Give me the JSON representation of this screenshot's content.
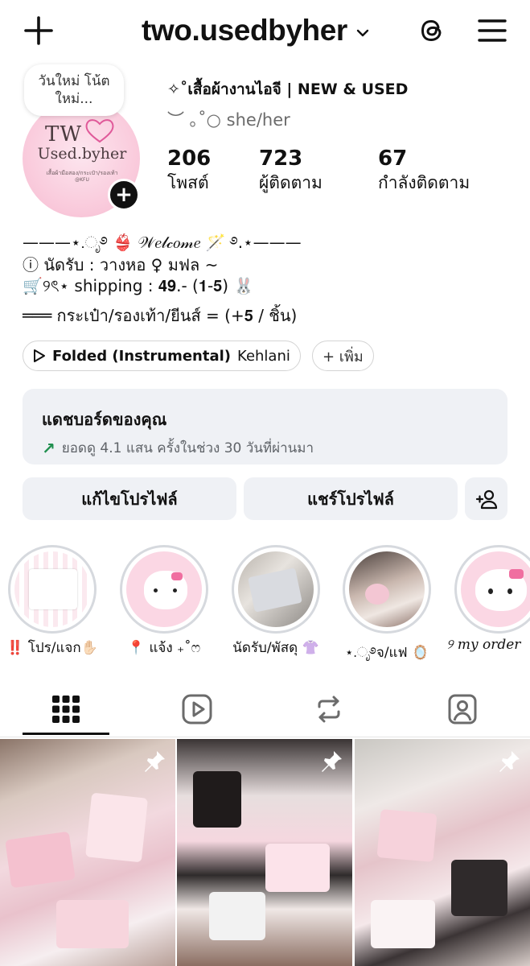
{
  "header": {
    "username": "two.usedbyher",
    "create_icon": "plus-icon",
    "threads_icon": "threads-icon",
    "menu_icon": "hamburger-menu-icon"
  },
  "profile": {
    "note": "วันใหม่ โน้ตใหม่...",
    "avatar_text": {
      "logo_tw": "TW",
      "logo_brand": "Used.byher",
      "logo_sub": "เสื้อผ้ามือสอง/กระเป๋า/รองเท้า",
      "logo_sub2": "@KFU"
    },
    "full_name": "✧˚เสื้อผ้างานไอจี | NEW & USED",
    "pronouns": "︶ ｡˚○ she/her",
    "stats": [
      {
        "count": "206",
        "label": "โพสต์"
      },
      {
        "count": "723",
        "label": "ผู้ติดตาม"
      },
      {
        "count": "67",
        "label": "กำลังติดตาม"
      }
    ]
  },
  "bio": {
    "line1": "———⋆.ೃ࿔ 👙 𝒲𝑒𝓁𝒸𝑜𝓂𝑒 🪄 ࿔.⋆———",
    "line2": "ⓘ นัดรับ : วางหอ ♀ มฟล ~",
    "line3": "🛒୨ৎ⋆ shipping : 𝟒𝟗.- (𝟏-𝟓) 🐰",
    "line4": "═══ กระเป๋า/รองเท้า/ยีนส์ = (+𝟓 / ชิ้น)"
  },
  "music": {
    "song": "Folded (Instrumental)",
    "artist": "Kehlani",
    "add_label": "+ เพิ่ม"
  },
  "dashboard": {
    "title": "แดชบอร์ดของคุณ",
    "stat": "ยอดดู 4.1 แสน ครั้งในช่วง 30 วันที่ผ่านมา"
  },
  "actions": {
    "edit": "แก้ไขโปรไฟล์",
    "share": "แชร์โปรไฟล์",
    "add_person_icon": "add-person-icon"
  },
  "highlights": [
    {
      "caption": "‼️ โปร/แจก✋🏻"
    },
    {
      "caption": "📍 แจ้ง ₊˚ෆ"
    },
    {
      "caption": "นัดรับ/พัสดุ 👚"
    },
    {
      "caption": "⋆.ೃ࿔จ/แฟ 🪞"
    },
    {
      "caption": "୨ my order"
    }
  ],
  "tabs": [
    "grid-icon",
    "reels-icon",
    "reposts-icon",
    "tagged-icon"
  ],
  "colors": {
    "accent_pink": "#f4b3c9",
    "chip_bg": "#eff1f5",
    "trend_green": "#1f8f4e",
    "muted_text": "#6b6b6b"
  }
}
